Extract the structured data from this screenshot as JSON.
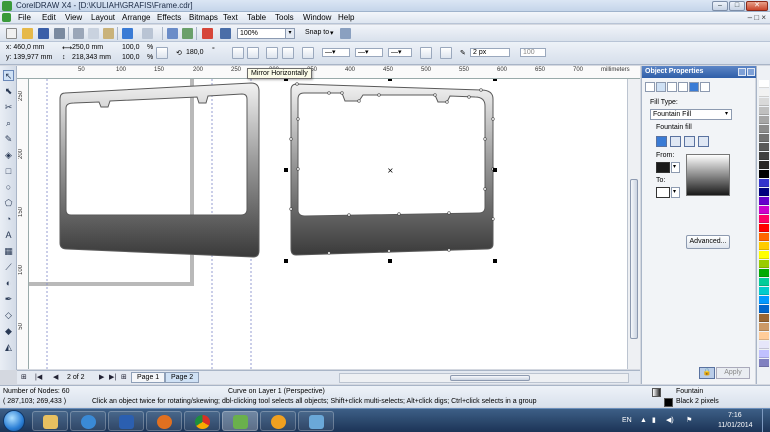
{
  "window": {
    "title": "CorelDRAW X4 - [D:\\KULIAH\\GRAFIS\\Frame.cdr]",
    "controls": {
      "minimize": "–",
      "maximize": "□",
      "close": "✕"
    }
  },
  "menu": {
    "items": [
      "File",
      "Edit",
      "View",
      "Layout",
      "Arrange",
      "Effects",
      "Bitmaps",
      "Text",
      "Table",
      "Tools",
      "Window",
      "Help"
    ],
    "doc_controls": "–  □  ×"
  },
  "toolbar": {
    "zoom": "100%",
    "snap_to": "Snap to",
    "snap_arrow": "▾"
  },
  "property_bar": {
    "x": "x: 460,0 mm",
    "y": "y: 139,977 mm",
    "width": "250,0 mm",
    "height": "218,343 mm",
    "scale_x": "100,0",
    "scale_y": "100,0",
    "pct": "%",
    "rotation": "180,0",
    "degree": "°",
    "outline_width": "2 px",
    "value_100": "100"
  },
  "tooltip": "Mirror Horizontally",
  "ruler": {
    "unit": "millimeters",
    "h_ticks": [
      "50",
      "100",
      "150",
      "200",
      "250",
      "300",
      "350",
      "400",
      "450",
      "500",
      "550",
      "600",
      "650",
      "700"
    ],
    "v_ticks": [
      "250",
      "200",
      "150",
      "100",
      "50"
    ]
  },
  "pages": {
    "counter": "2 of 2",
    "tabs": [
      "Page 1",
      "Page 2"
    ],
    "active": "Page 2"
  },
  "docker": {
    "title": "Object Properties",
    "fill_type_label": "Fill Type:",
    "fill_type_value": "Fountain Fill",
    "fountain_fill_label": "Fountain fill",
    "from_label": "From:",
    "to_label": "To:",
    "advanced_label": "Advanced...",
    "apply_label": "Apply",
    "lock_icon": "lock-icon",
    "from_color": "#1a1a1a",
    "to_color": "#ffffff"
  },
  "palette_colors": [
    "#ffffff",
    "#f2f2f2",
    "#d9d9d9",
    "#bfbfbf",
    "#a6a6a6",
    "#8c8c8c",
    "#737373",
    "#595959",
    "#404040",
    "#262626",
    "#000000",
    "#3333cc",
    "#000080",
    "#6600cc",
    "#cc00cc",
    "#ff0066",
    "#ff0000",
    "#ff6600",
    "#ffcc00",
    "#ffff00",
    "#99cc00",
    "#00aa00",
    "#00cc99",
    "#00cccc",
    "#0099ff",
    "#0066cc",
    "#996633",
    "#cc9966",
    "#ffcc99",
    "#e6e6fa",
    "#c0c0ff",
    "#8080c0"
  ],
  "status": {
    "nodes": "Number of Nodes: 60",
    "curve": "Curve on Layer 1  (Perspective)",
    "coords": "( 287,103; 269,433 )",
    "hint": "Click an object twice for rotating/skewing; dbl-clicking tool selects all objects; Shift+click multi-selects; Alt+click digs; Ctrl+click selects in a group",
    "fill_name": "Fountain",
    "outline_name": "Black  2 pixels"
  },
  "taskbar": {
    "lang": "EN",
    "time": "7:16",
    "date": "11/01/2014"
  }
}
